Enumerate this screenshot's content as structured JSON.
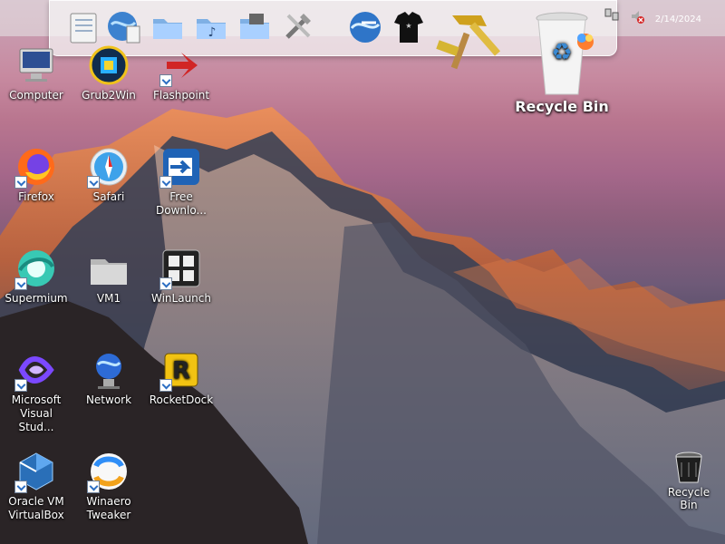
{
  "clock": "2/14/2024",
  "desktop": {
    "icons": [
      {
        "label": "Computer"
      },
      {
        "label": "Grub2Win"
      },
      {
        "label": "Flashpoint"
      },
      {
        "label": "Firefox"
      },
      {
        "label": "Safari"
      },
      {
        "label": "Free\nDownlo..."
      },
      {
        "label": "Supermium"
      },
      {
        "label": "VM1"
      },
      {
        "label": "WinLaunch"
      },
      {
        "label": "Microsoft\nVisual Stud..."
      },
      {
        "label": "Network"
      },
      {
        "label": "RocketDock"
      },
      {
        "label": "Oracle VM\nVirtualBox"
      },
      {
        "label": "Winaero\nTweaker"
      }
    ]
  },
  "big_recycle_bin": {
    "label": "Recycle Bin"
  },
  "small_recycle_bin": {
    "label": "Recycle Bin"
  }
}
